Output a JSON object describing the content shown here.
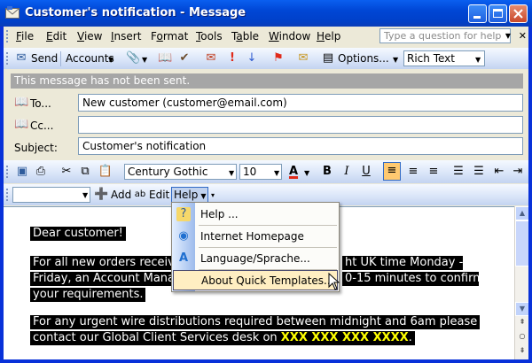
{
  "window": {
    "title": "Customer's notification - Message"
  },
  "menubar": {
    "items": [
      "File",
      "Edit",
      "View",
      "Insert",
      "Format",
      "Tools",
      "Table",
      "Window",
      "Help"
    ],
    "underline": [
      "F",
      "E",
      "V",
      "I",
      "o",
      "T",
      "a",
      "W",
      "H"
    ],
    "ask_placeholder": "Type a question for help"
  },
  "standard_toolbar": {
    "send": "Send",
    "accounts": "Accounts",
    "options": "Options...",
    "format": "Rich Text"
  },
  "info": {
    "message": "This message has not been sent."
  },
  "header": {
    "to_label": "To...",
    "to_value": "New customer (customer@email.com)",
    "cc_label": "Cc...",
    "cc_value": "",
    "subject_label": "Subject:",
    "subject_value": "Customer's notification"
  },
  "formatting_toolbar": {
    "font": "Century Gothic",
    "size": "10"
  },
  "templates_toolbar": {
    "add": "Add",
    "edit": "Edit",
    "help": "Help"
  },
  "help_menu": {
    "items": [
      {
        "label": "Help ...",
        "icon": "help-book-icon"
      },
      {
        "label": "Internet Homepage",
        "icon": "globe-icon"
      },
      {
        "label": "Language/Sprache...",
        "icon": "language-icon"
      },
      {
        "label": "About Quick Templates...",
        "icon": ""
      }
    ]
  },
  "body": {
    "line1": "Dear customer!",
    "line2a": "For all new orders receive",
    "line2b": "ht UK time Monday -",
    "line3a": "Friday, an Account Manag",
    "line3b": "0-15 minutes to confirm",
    "line4": "your requirements.",
    "line5": "For any urgent wire distributions required between midnight and 6am please",
    "line6a": "contact our Global Client Services desk on ",
    "line6b": "XXX XXX XXX XXXX",
    "line6c": "."
  },
  "colors": {
    "titlebar": "#0046D5",
    "highlight": "#FFFF00",
    "menu_hover": "#FFEEC2"
  }
}
